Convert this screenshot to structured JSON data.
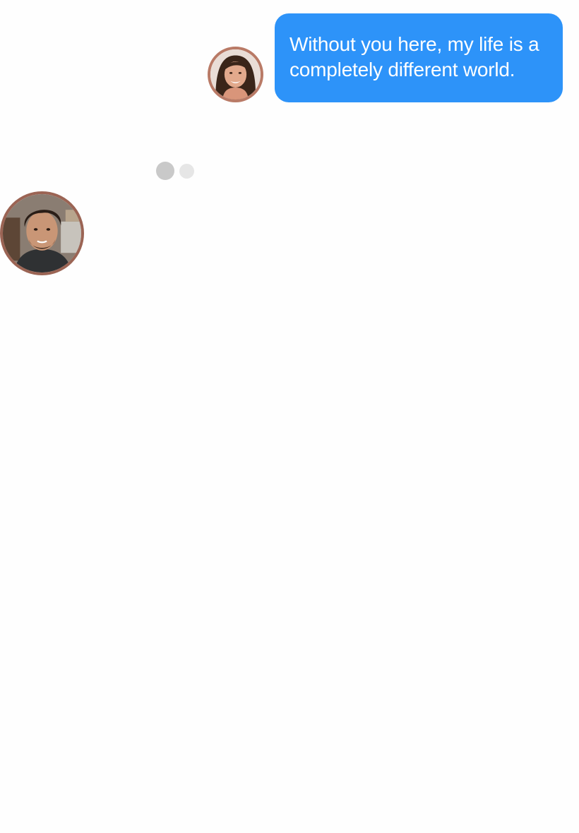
{
  "conversation": {
    "outgoing_message": {
      "text": "Without you here, my life is a completely different world.",
      "bubble_color": "#2d93f9",
      "text_color": "#ffffff"
    },
    "sender_avatar": {
      "icon": "woman-portrait-avatar",
      "ring_color": "#b97a66"
    },
    "typing_indicator": {
      "state": "typing",
      "dot_colors": [
        "#c9c9c9",
        "#e6e6e6"
      ]
    },
    "recipient_avatar": {
      "icon": "man-portrait-avatar",
      "ring_color": "#9b6454"
    }
  }
}
